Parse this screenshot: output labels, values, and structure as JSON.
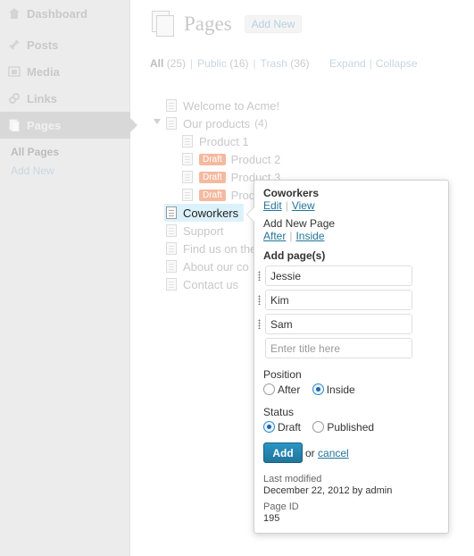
{
  "sidebar": {
    "menu": [
      {
        "label": "Dashboard",
        "icon": "dashboard-icon"
      },
      {
        "label": "Posts",
        "icon": "pin-icon"
      },
      {
        "label": "Media",
        "icon": "media-icon"
      },
      {
        "label": "Links",
        "icon": "link-icon"
      },
      {
        "label": "Pages",
        "icon": "pages-icon",
        "active": true
      }
    ],
    "submenu": [
      {
        "label": "All Pages",
        "current": true
      },
      {
        "label": "Add New"
      }
    ]
  },
  "header": {
    "title": "Pages",
    "add_new": "Add New"
  },
  "filters": {
    "all_label": "All",
    "all_count": "(25)",
    "public_label": "Public",
    "public_count": "(16)",
    "trash_label": "Trash",
    "trash_count": "(36)",
    "expand": "Expand",
    "collapse": "Collapse"
  },
  "tree": {
    "welcome": "Welcome to Acme!",
    "products": "Our products",
    "products_count": "(4)",
    "product1": "Product 1",
    "product2": "Product 2",
    "product3": "Product 3",
    "product4": "Prod",
    "coworkers": "Coworkers",
    "support": "Support",
    "findus": "Find us on the",
    "about": "About our co",
    "contact": "Contact us",
    "draft_badge": "Draft"
  },
  "popup": {
    "title": "Coworkers",
    "edit": "Edit",
    "view": "View",
    "add_new_page": "Add New Page",
    "after_link": "After",
    "inside_link": "Inside",
    "add_pages_heading": "Add page(s)",
    "inputs": [
      "Jessie",
      "Kim",
      "Sam"
    ],
    "placeholder": "Enter title here",
    "position_label": "Position",
    "position_options": [
      "After",
      "Inside"
    ],
    "position_selected": "Inside",
    "status_label": "Status",
    "status_options": [
      "Draft",
      "Published"
    ],
    "status_selected": "Draft",
    "add_button": "Add",
    "or_text": "or",
    "cancel_link": "cancel",
    "last_modified_label": "Last modified",
    "last_modified_value": "December 22, 2012 by admin",
    "page_id_label": "Page ID",
    "page_id_value": "195"
  },
  "colors": {
    "link": "#21759b",
    "primary_button": "#21759b",
    "draft_badge": "#f5b9a0",
    "highlight_row": "#dcf2fb"
  }
}
